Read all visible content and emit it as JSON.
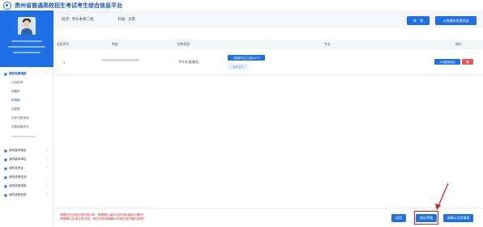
{
  "app": {
    "title": "贵州省普通高校招生考试考生综合信息平台"
  },
  "filters": {
    "batch_label": "批次:",
    "batch_value": "专升本第二批",
    "subject_label": "科类:",
    "subject_value": "文史"
  },
  "toolbar": {
    "add_label": "新　增",
    "batch_add_label": "从收藏夹批量添加"
  },
  "table": {
    "columns": [
      "志愿序号",
      "院校",
      "招考类型",
      "专业",
      "操作"
    ],
    "rows": [
      {
        "seq": "1",
        "type": "专升本(普通类)",
        "major_button": "请选择专业(已选0/4个)",
        "major_tag": "此专业不",
        "action_fav": "从收藏夹添加",
        "action_delete": "删"
      }
    ]
  },
  "sidebar": {
    "groups": [
      {
        "label": "我的志愿填报",
        "expanded": true
      },
      {
        "label": "我的高考报名",
        "expanded": false
      },
      {
        "label": "我的高考体检",
        "expanded": false
      },
      {
        "label": "我的准考证",
        "expanded": false
      },
      {
        "label": "我的成绩查询",
        "expanded": false
      },
      {
        "label": "我的录取快报",
        "expanded": false
      },
      {
        "label": "我的录取信息",
        "expanded": false
      }
    ],
    "sub_items": [
      "计划查询",
      "收藏夹",
      "草稿箱",
      "志愿表",
      "历史志愿查询",
      "志愿填报状态"
    ]
  },
  "bottom": {
    "warn_line1": "草稿在此页面选择志愿0条，草稿确认保存志愿0条(保存后删除)",
    "warn_line2": "草稿确认前请注意志愿，请在对所草稿确认前请志愿完整志愿表!",
    "return_label": "返回",
    "save_label": "保存草稿",
    "submit_label": "请确认志愿填报"
  },
  "colors": {
    "primary": "#1f6fe5",
    "danger": "#e35a5a",
    "warning_text": "#d9302c",
    "highlight": "#e02020"
  }
}
